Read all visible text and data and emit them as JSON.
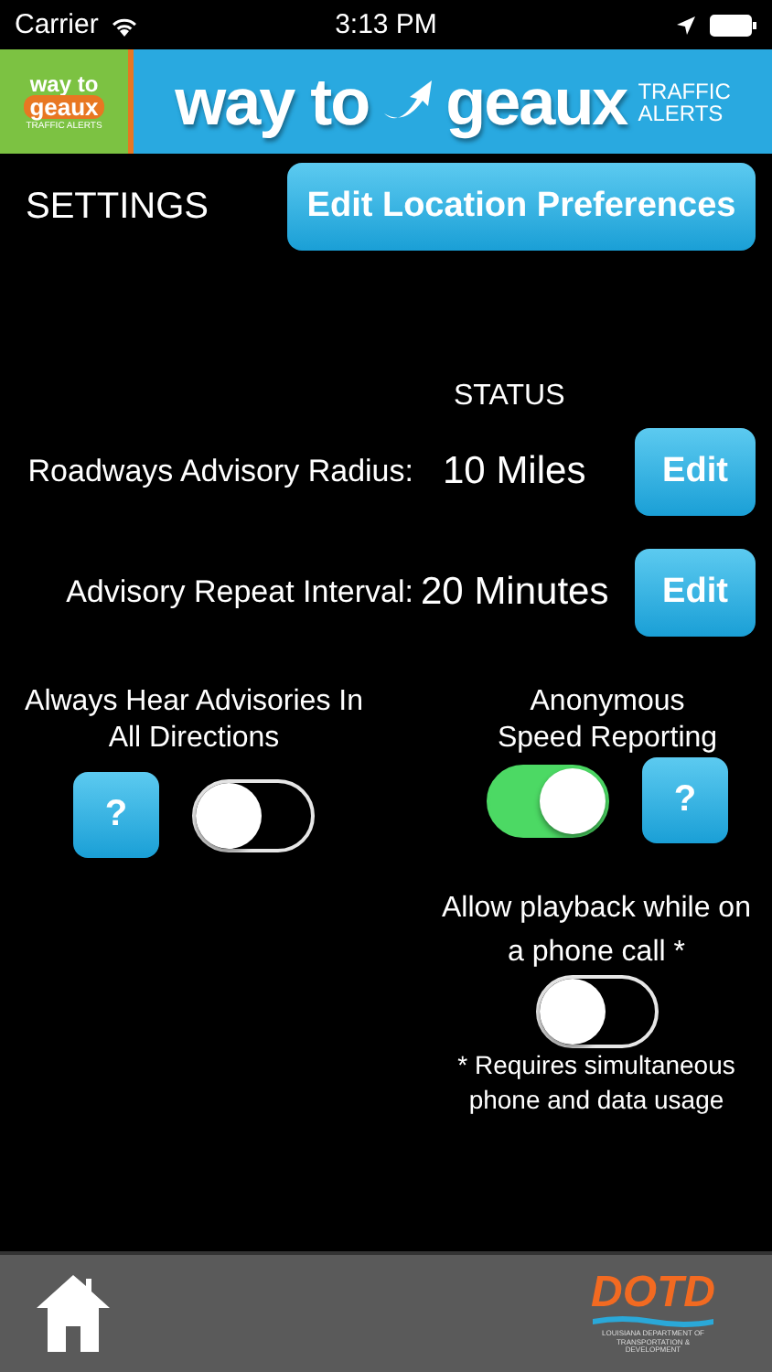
{
  "status_bar": {
    "carrier": "Carrier",
    "time": "3:13 PM"
  },
  "banner": {
    "small_logo": {
      "line1": "way to",
      "line2": "geaux",
      "line3": "TRAFFIC ALERTS"
    },
    "title_left": "way to",
    "title_right": "geaux",
    "subtitle_1": "TRAFFIC",
    "subtitle_2": "ALERTS"
  },
  "header": {
    "title": "SETTINGS",
    "button": "Edit Location Preferences"
  },
  "status_heading": "STATUS",
  "settings": [
    {
      "label": "Roadways Advisory Radius:",
      "value": "10 Miles",
      "button": "Edit"
    },
    {
      "label": "Advisory Repeat Interval:",
      "value": "20 Minutes",
      "button": "Edit"
    }
  ],
  "toggles": [
    {
      "label": "Always Hear Advisories In All Directions",
      "on": false,
      "help": "?",
      "kind": "help_left"
    },
    {
      "label": "Anonymous Speed Reporting",
      "on": true,
      "help": "?",
      "kind": "help_right"
    }
  ],
  "playback": {
    "label": "Allow playback while on a phone call *",
    "on": false,
    "note": "* Requires simultaneous phone and data usage"
  },
  "footer": {
    "logo": "DOTD",
    "logo_caption": "LOUISIANA DEPARTMENT OF TRANSPORTATION & DEVELOPMENT"
  }
}
